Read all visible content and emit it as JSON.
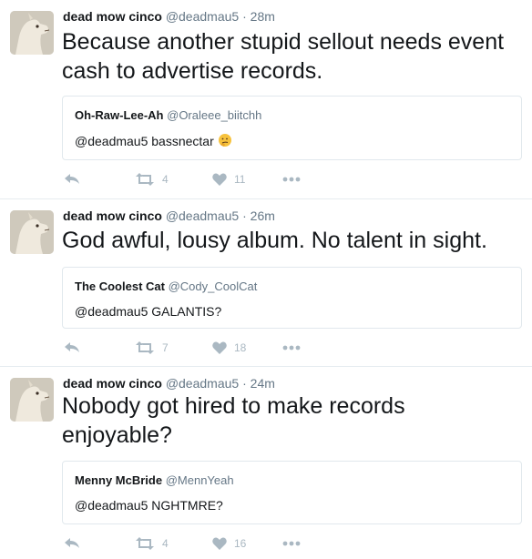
{
  "tweets": [
    {
      "author_name": "dead mow cinco",
      "author_handle": "@deadmau5",
      "separator": "·",
      "time": "28m",
      "text": "Because another stupid sellout needs event cash to advertise records.",
      "quote": {
        "name": "Oh-Raw-Lee-Ah",
        "handle": "@Oraleee_biitchh",
        "text": "@deadmau5 bassnectar",
        "emoji": "thinking-face-icon"
      },
      "retweets": "4",
      "likes": "11"
    },
    {
      "author_name": "dead mow cinco",
      "author_handle": "@deadmau5",
      "separator": "·",
      "time": "26m",
      "text": "God awful, lousy album. No talent in sight.",
      "quote": {
        "name": "The Coolest Cat",
        "handle": "@Cody_CoolCat",
        "text": "@deadmau5 GALANTIS?"
      },
      "retweets": "7",
      "likes": "18"
    },
    {
      "author_name": "dead mow cinco",
      "author_handle": "@deadmau5",
      "separator": "·",
      "time": "24m",
      "text": "Nobody got hired to make records enjoyable?",
      "quote": {
        "name": "Menny McBride",
        "handle": "@MennYeah",
        "text": "@deadmau5 NGHTMRE?"
      },
      "retweets": "4",
      "likes": "16"
    }
  ],
  "colors": {
    "muted": "#657786",
    "icon": "#aab8c2",
    "border": "#e1e8ed",
    "text": "#14171a"
  },
  "icons": [
    "reply-icon",
    "retweet-icon",
    "heart-icon",
    "more-icon"
  ]
}
